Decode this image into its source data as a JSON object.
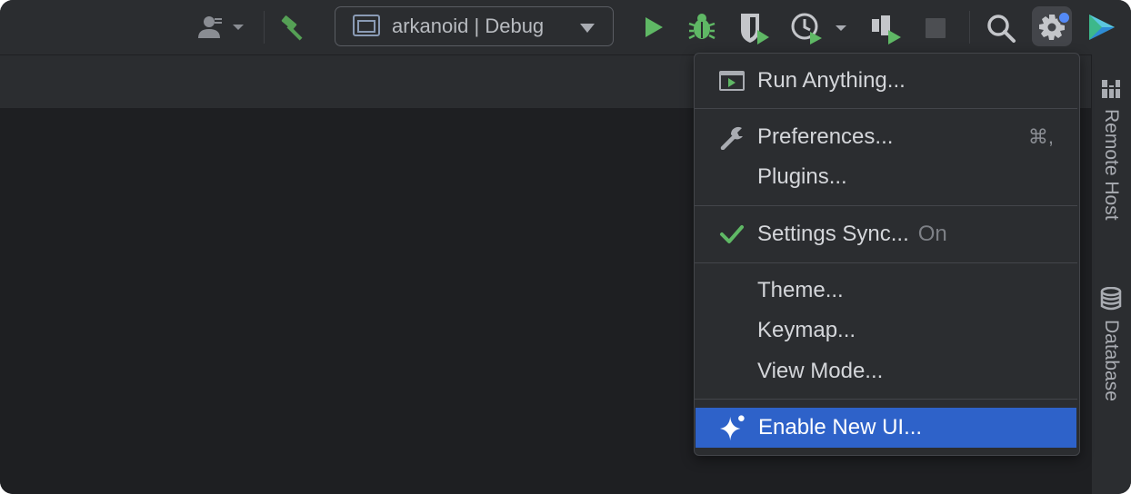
{
  "toolbar": {
    "run_config_label": "arkanoid | Debug",
    "icons": [
      "user-icon",
      "build-hammer-icon",
      "run-config-window-icon",
      "run-icon",
      "debug-bug-icon",
      "coverage-icon",
      "profile-icon",
      "attach-debugger-icon",
      "stop-icon",
      "search-icon",
      "gear-icon",
      "app-logo-icon"
    ]
  },
  "menu": {
    "run_anything": "Run Anything...",
    "preferences": "Preferences...",
    "preferences_shortcut": "⌘,",
    "plugins": "Plugins...",
    "settings_sync": "Settings Sync...",
    "settings_sync_status": "On",
    "theme": "Theme...",
    "keymap": "Keymap...",
    "view_mode": "View Mode...",
    "enable_new_ui": "Enable New UI..."
  },
  "right_tabs": {
    "remote_host": "Remote Host",
    "database": "Database"
  },
  "colors": {
    "accent_selected": "#2e62c9",
    "run_green": "#5fb865",
    "notification_dot": "#548af7"
  }
}
